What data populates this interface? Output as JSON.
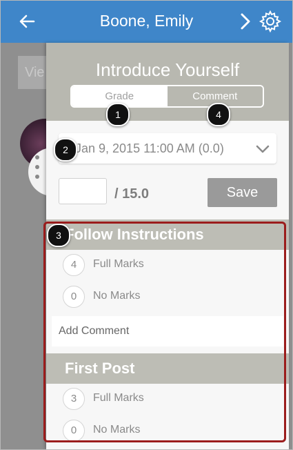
{
  "header": {
    "title": "Boone, Emily",
    "back_icon": "arrow-left-icon",
    "next_icon": "chevron-right-icon",
    "settings_icon": "gear-icon",
    "color": "#3f86c9"
  },
  "background": {
    "view_button_partial": "Vie"
  },
  "panel": {
    "assignment_title": "Introduce Yourself",
    "tabs": [
      {
        "label": "Grade",
        "selected": true
      },
      {
        "label": "Comment",
        "selected": false
      }
    ],
    "submission_select": {
      "value": "Jan 9, 2015 11:00 AM (0.0)",
      "icon": "chevron-down-icon"
    },
    "score": {
      "value": "",
      "total": "/ 15.0"
    },
    "save_label": "Save",
    "rubric": {
      "criteria": [
        {
          "title": "Follow Instructions",
          "ratings": [
            {
              "points": "4",
              "label": "Full Marks"
            },
            {
              "points": "0",
              "label": "No Marks"
            }
          ],
          "comment_placeholder": "Add Comment"
        },
        {
          "title": "First Post",
          "ratings": [
            {
              "points": "3",
              "label": "Full Marks"
            },
            {
              "points": "0",
              "label": "No Marks"
            }
          ]
        }
      ]
    }
  },
  "callouts": [
    "1",
    "2",
    "3",
    "4"
  ],
  "colors": {
    "highlight": "#9b1c1c",
    "callout": "#111111"
  }
}
